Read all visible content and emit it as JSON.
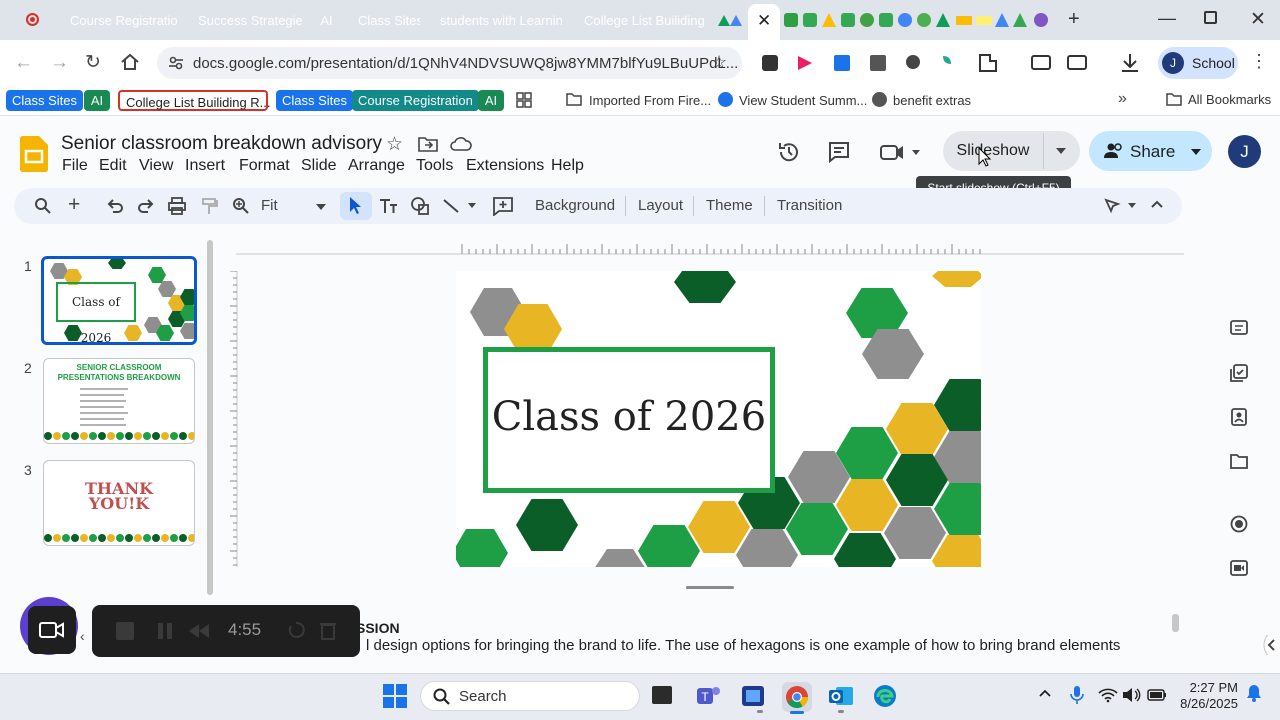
{
  "browser": {
    "tabs": [
      {
        "label": "Course Registration",
        "color": "#128a8a"
      },
      {
        "label": "Success Strategies",
        "color": "#e0a800"
      },
      {
        "label": "AI",
        "color": "#1a8a54"
      },
      {
        "label": "Class Sites",
        "color": "#1a73e8"
      },
      {
        "label": "students with Learnin",
        "color": "#5f6368"
      },
      {
        "label": "College List Builiding",
        "color": "#d93025"
      }
    ],
    "url": "docs.google.com/presentation/d/1QNhV4NDVSUWQ8jw8YMM7blfYu9LBuUPdL...",
    "profile_label": "School",
    "profile_initial": "J"
  },
  "bookmarks": [
    {
      "label": "Class Sites",
      "style": "blue"
    },
    {
      "label": "AI",
      "style": "green"
    },
    {
      "label": "College List Builiding R...",
      "style": "red"
    },
    {
      "label": "Class Sites",
      "style": "blue"
    },
    {
      "label": "Course Registration",
      "style": "teal"
    },
    {
      "label": "AI",
      "style": "green"
    },
    {
      "label": "Imported From Fire...",
      "style": "plain"
    },
    {
      "label": "View Student Summ...",
      "style": "plain"
    },
    {
      "label": "benefit extras",
      "style": "plain"
    }
  ],
  "all_bookmarks": "All Bookmarks",
  "doc": {
    "title": "Senior classroom breakdown advisory",
    "menu": [
      "File",
      "Edit",
      "View",
      "Insert",
      "Format",
      "Slide",
      "Arrange",
      "Tools",
      "Extensions",
      "Help"
    ],
    "slideshow_label": "Slideshow",
    "share_label": "Share",
    "user_initial": "J",
    "tooltip": "Start slideshow (Ctrl+F5)"
  },
  "toolbar": {
    "zoom": "Fit",
    "background": "Background",
    "layout": "Layout",
    "theme": "Theme",
    "transition": "Transition"
  },
  "slides": [
    {
      "number": "1",
      "title": "Class of 2026"
    },
    {
      "number": "2",
      "title": "SENIOR CLASSROOM PRESENTATIONS BREAKDOWN"
    },
    {
      "number": "3",
      "title": "THANK YOU!K"
    }
  ],
  "main_slide": {
    "title": "Class of 2026"
  },
  "notes": {
    "heading": "SSION",
    "text": "l design options for bringing the brand to life. The use of hexagons is one example of how to bring brand elements"
  },
  "recorder": {
    "time": "4:55"
  },
  "taskbar": {
    "search": "Search",
    "time": "2:27 PM",
    "date": "8/26/2025"
  }
}
